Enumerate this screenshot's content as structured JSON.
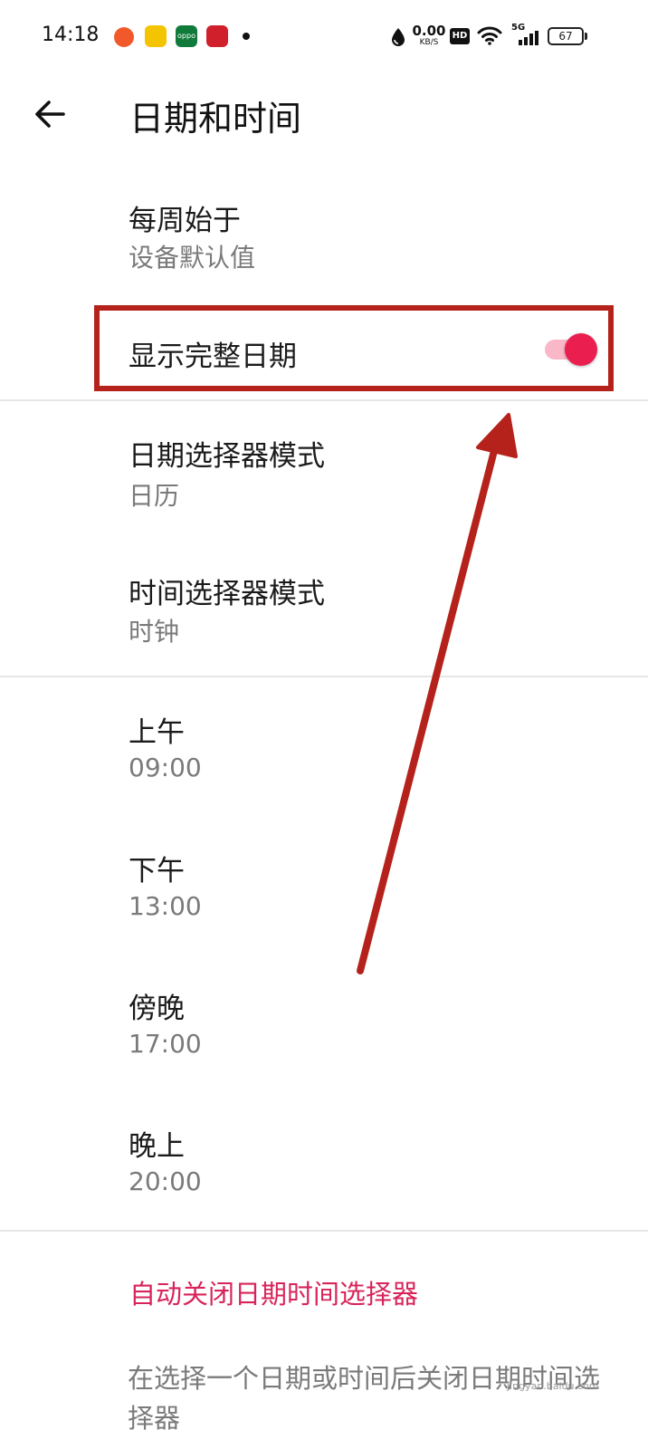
{
  "status_bar": {
    "time": "14:18",
    "net_speed_value": "0.00",
    "net_speed_unit": "KB/S",
    "hd_badge": "HD",
    "network_type": "5G",
    "battery_level": "67",
    "app_icon_oppo": "oppo"
  },
  "header": {
    "back_icon": "arrow-left-icon",
    "title": "日期和时间"
  },
  "settings": {
    "week_start": {
      "title": "每周始于",
      "value": "设备默认值"
    },
    "show_full_date": {
      "title": "显示完整日期",
      "enabled": true
    },
    "date_picker_mode": {
      "title": "日期选择器模式",
      "value": "日历"
    },
    "time_picker_mode": {
      "title": "时间选择器模式",
      "value": "时钟"
    },
    "morning": {
      "title": "上午",
      "value": "09:00"
    },
    "afternoon": {
      "title": "下午",
      "value": "13:00"
    },
    "evening": {
      "title": "傍晚",
      "value": "17:00"
    },
    "night": {
      "title": "晚上",
      "value": "20:00"
    }
  },
  "auto_close": {
    "title": "自动关闭日期时间选择器",
    "description": "在选择一个日期或时间后关闭日期时间选择器"
  },
  "watermark": "jingyan.baidu.com",
  "colors": {
    "accent": "#ea1f4f",
    "accent_track": "#f9b7c8",
    "link": "#d8245a",
    "annotation": "#b5221c",
    "secondary_text": "#7a7a7a",
    "divider": "#e6e6e6"
  }
}
